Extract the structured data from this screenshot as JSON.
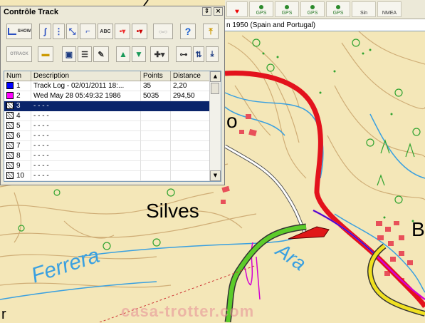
{
  "window": {
    "title": "Contrôle Track",
    "pin_glyph": "⇕",
    "close_glyph": "×"
  },
  "toolbar_row1": {
    "show_label": "SHOW",
    "abc_label": "ABC",
    "help_glyph": "?"
  },
  "toolbar_row2": {
    "otrack_label": "OTRACK"
  },
  "map_toolbar": {
    "buttons": [
      "GPS",
      "GPS",
      "GPS",
      "GPS",
      "Sin",
      "NMEA"
    ]
  },
  "datum": "n 1950 (Spain and Portugal)",
  "table": {
    "columns": [
      "Num",
      "Description",
      "Points",
      "Distance"
    ],
    "rows": [
      {
        "num": "1",
        "color": "#0000ff",
        "description": "Track Log - 02/01/2011 18:...",
        "points": "35",
        "distance": "2,20"
      },
      {
        "num": "2",
        "color": "#ff00ff",
        "description": "Wed May 28 05:49:32 1986",
        "points": "5035",
        "distance": "294,50"
      },
      {
        "num": "3",
        "color": "",
        "description": "- - - -",
        "points": "",
        "distance": ""
      },
      {
        "num": "4",
        "color": "",
        "description": "- - - -",
        "points": "",
        "distance": ""
      },
      {
        "num": "5",
        "color": "",
        "description": "- - - -",
        "points": "",
        "distance": ""
      },
      {
        "num": "6",
        "color": "",
        "description": "- - - -",
        "points": "",
        "distance": ""
      },
      {
        "num": "7",
        "color": "",
        "description": "- - - -",
        "points": "",
        "distance": ""
      },
      {
        "num": "8",
        "color": "",
        "description": "- - - -",
        "points": "",
        "distance": ""
      },
      {
        "num": "9",
        "color": "",
        "description": "- - - -",
        "points": "",
        "distance": ""
      },
      {
        "num": "10",
        "color": "",
        "description": "- - - -",
        "points": "",
        "distance": ""
      }
    ],
    "selected_row": "3"
  },
  "map_labels": {
    "town": "Silves",
    "river": "Ferrera",
    "river2": "Ara",
    "partial_o": "o",
    "partial_b": "B",
    "partial_r": "r"
  },
  "watermark": "casa-trotter.com"
}
